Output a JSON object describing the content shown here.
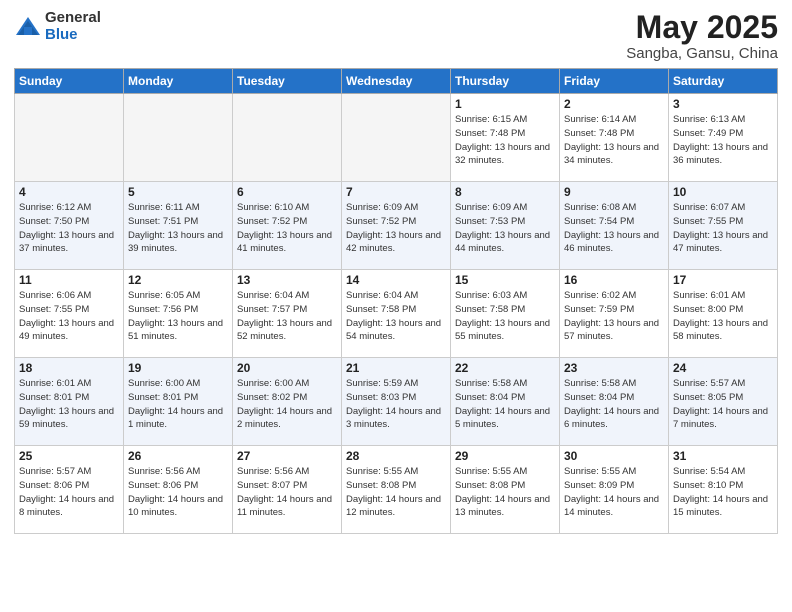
{
  "header": {
    "logo_general": "General",
    "logo_blue": "Blue",
    "main_title": "May 2025",
    "subtitle": "Sangba, Gansu, China"
  },
  "days_of_week": [
    "Sunday",
    "Monday",
    "Tuesday",
    "Wednesday",
    "Thursday",
    "Friday",
    "Saturday"
  ],
  "weeks": [
    [
      {
        "day": "",
        "info": ""
      },
      {
        "day": "",
        "info": ""
      },
      {
        "day": "",
        "info": ""
      },
      {
        "day": "",
        "info": ""
      },
      {
        "day": "1",
        "info": "Sunrise: 6:15 AM\nSunset: 7:48 PM\nDaylight: 13 hours\nand 32 minutes."
      },
      {
        "day": "2",
        "info": "Sunrise: 6:14 AM\nSunset: 7:48 PM\nDaylight: 13 hours\nand 34 minutes."
      },
      {
        "day": "3",
        "info": "Sunrise: 6:13 AM\nSunset: 7:49 PM\nDaylight: 13 hours\nand 36 minutes."
      }
    ],
    [
      {
        "day": "4",
        "info": "Sunrise: 6:12 AM\nSunset: 7:50 PM\nDaylight: 13 hours\nand 37 minutes."
      },
      {
        "day": "5",
        "info": "Sunrise: 6:11 AM\nSunset: 7:51 PM\nDaylight: 13 hours\nand 39 minutes."
      },
      {
        "day": "6",
        "info": "Sunrise: 6:10 AM\nSunset: 7:52 PM\nDaylight: 13 hours\nand 41 minutes."
      },
      {
        "day": "7",
        "info": "Sunrise: 6:09 AM\nSunset: 7:52 PM\nDaylight: 13 hours\nand 42 minutes."
      },
      {
        "day": "8",
        "info": "Sunrise: 6:09 AM\nSunset: 7:53 PM\nDaylight: 13 hours\nand 44 minutes."
      },
      {
        "day": "9",
        "info": "Sunrise: 6:08 AM\nSunset: 7:54 PM\nDaylight: 13 hours\nand 46 minutes."
      },
      {
        "day": "10",
        "info": "Sunrise: 6:07 AM\nSunset: 7:55 PM\nDaylight: 13 hours\nand 47 minutes."
      }
    ],
    [
      {
        "day": "11",
        "info": "Sunrise: 6:06 AM\nSunset: 7:55 PM\nDaylight: 13 hours\nand 49 minutes."
      },
      {
        "day": "12",
        "info": "Sunrise: 6:05 AM\nSunset: 7:56 PM\nDaylight: 13 hours\nand 51 minutes."
      },
      {
        "day": "13",
        "info": "Sunrise: 6:04 AM\nSunset: 7:57 PM\nDaylight: 13 hours\nand 52 minutes."
      },
      {
        "day": "14",
        "info": "Sunrise: 6:04 AM\nSunset: 7:58 PM\nDaylight: 13 hours\nand 54 minutes."
      },
      {
        "day": "15",
        "info": "Sunrise: 6:03 AM\nSunset: 7:58 PM\nDaylight: 13 hours\nand 55 minutes."
      },
      {
        "day": "16",
        "info": "Sunrise: 6:02 AM\nSunset: 7:59 PM\nDaylight: 13 hours\nand 57 minutes."
      },
      {
        "day": "17",
        "info": "Sunrise: 6:01 AM\nSunset: 8:00 PM\nDaylight: 13 hours\nand 58 minutes."
      }
    ],
    [
      {
        "day": "18",
        "info": "Sunrise: 6:01 AM\nSunset: 8:01 PM\nDaylight: 13 hours\nand 59 minutes."
      },
      {
        "day": "19",
        "info": "Sunrise: 6:00 AM\nSunset: 8:01 PM\nDaylight: 14 hours\nand 1 minute."
      },
      {
        "day": "20",
        "info": "Sunrise: 6:00 AM\nSunset: 8:02 PM\nDaylight: 14 hours\nand 2 minutes."
      },
      {
        "day": "21",
        "info": "Sunrise: 5:59 AM\nSunset: 8:03 PM\nDaylight: 14 hours\nand 3 minutes."
      },
      {
        "day": "22",
        "info": "Sunrise: 5:58 AM\nSunset: 8:04 PM\nDaylight: 14 hours\nand 5 minutes."
      },
      {
        "day": "23",
        "info": "Sunrise: 5:58 AM\nSunset: 8:04 PM\nDaylight: 14 hours\nand 6 minutes."
      },
      {
        "day": "24",
        "info": "Sunrise: 5:57 AM\nSunset: 8:05 PM\nDaylight: 14 hours\nand 7 minutes."
      }
    ],
    [
      {
        "day": "25",
        "info": "Sunrise: 5:57 AM\nSunset: 8:06 PM\nDaylight: 14 hours\nand 8 minutes."
      },
      {
        "day": "26",
        "info": "Sunrise: 5:56 AM\nSunset: 8:06 PM\nDaylight: 14 hours\nand 10 minutes."
      },
      {
        "day": "27",
        "info": "Sunrise: 5:56 AM\nSunset: 8:07 PM\nDaylight: 14 hours\nand 11 minutes."
      },
      {
        "day": "28",
        "info": "Sunrise: 5:55 AM\nSunset: 8:08 PM\nDaylight: 14 hours\nand 12 minutes."
      },
      {
        "day": "29",
        "info": "Sunrise: 5:55 AM\nSunset: 8:08 PM\nDaylight: 14 hours\nand 13 minutes."
      },
      {
        "day": "30",
        "info": "Sunrise: 5:55 AM\nSunset: 8:09 PM\nDaylight: 14 hours\nand 14 minutes."
      },
      {
        "day": "31",
        "info": "Sunrise: 5:54 AM\nSunset: 8:10 PM\nDaylight: 14 hours\nand 15 minutes."
      }
    ]
  ]
}
